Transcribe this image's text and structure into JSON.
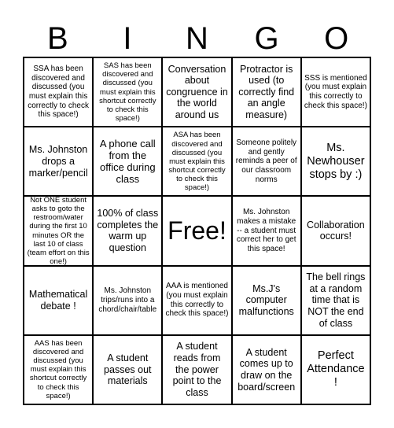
{
  "header": {
    "letters": [
      "B",
      "I",
      "N",
      "G",
      "O"
    ]
  },
  "board": {
    "rows": [
      [
        {
          "text": "SSA has been discovered and discussed (you must explain this correctly to check this space!)",
          "size": "fs-s"
        },
        {
          "text": "SAS has been discovered and discussed (you must explain this shortcut correctly to check this space!)",
          "size": "fs-xs"
        },
        {
          "text": "Conversation about congruence in the world around us",
          "size": "fs-l"
        },
        {
          "text": "Protractor is used (to correctly find an angle measure)",
          "size": "fs-l"
        },
        {
          "text": "SSS is mentioned (you must explain this correctly to check this space!)",
          "size": "fs-s"
        }
      ],
      [
        {
          "text": "Ms. Johnston drops a marker/pencil",
          "size": "fs-l"
        },
        {
          "text": "A phone call from the office during class",
          "size": "fs-xl"
        },
        {
          "text": "ASA has been discovered and discussed (you must explain this shortcut correctly to check this space!)",
          "size": "fs-xs"
        },
        {
          "text": "Someone politely and gently reminds a peer of our classroom norms",
          "size": "fs-s"
        },
        {
          "text": "Ms. Newhouser stops by :)",
          "size": "fs-xxl"
        }
      ],
      [
        {
          "text": "Not ONE student asks to goto the restroom/water during the first 10 minutes OR the last 10 of class (team effort on this one!)",
          "size": "fs-xs"
        },
        {
          "text": "100% of class completes the warm up question",
          "size": "fs-l"
        },
        {
          "text": "Free!",
          "size": "fs-free"
        },
        {
          "text": "Ms. Johnston makes a mistake -- a student must correct her to get this space!",
          "size": "fs-s"
        },
        {
          "text": "Collaboration occurs!",
          "size": "fs-l"
        }
      ],
      [
        {
          "text": "Mathematical debate !",
          "size": "fs-l"
        },
        {
          "text": "Ms. Johnston trips/runs into a chord/chair/table",
          "size": "fs-s"
        },
        {
          "text": "AAA is mentioned (you must explain this correctly to check this space!)",
          "size": "fs-s"
        },
        {
          "text": "Ms.J's computer malfunctions",
          "size": "fs-l"
        },
        {
          "text": "The bell rings at a random time that is NOT the end of class",
          "size": "fs-l"
        }
      ],
      [
        {
          "text": "AAS has been discovered and discussed (you must explain this shortcut correctly to check this space!)",
          "size": "fs-xs"
        },
        {
          "text": "A student passes out materials",
          "size": "fs-l"
        },
        {
          "text": "A student reads from the power point to the class",
          "size": "fs-l"
        },
        {
          "text": "A student comes up to draw on the board/screen",
          "size": "fs-l"
        },
        {
          "text": "Perfect Attendance !",
          "size": "fs-xxl"
        }
      ]
    ]
  }
}
